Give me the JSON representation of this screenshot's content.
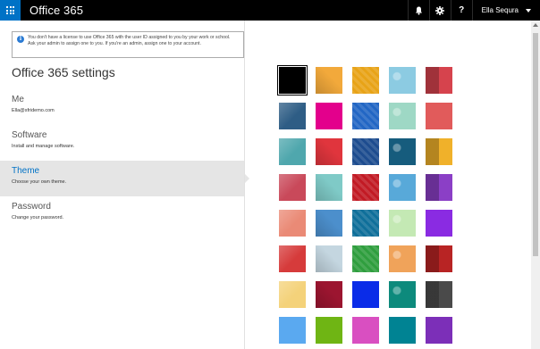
{
  "app": {
    "brand": "Office 365"
  },
  "topbar": {
    "user_name": "Ella Sequra",
    "icons": [
      "bell-icon",
      "gear-icon",
      "help-icon"
    ],
    "help_glyph": "?"
  },
  "notice": {
    "text": "You don't have a license to use Office 365 with the user ID assigned to you by your work or school. Ask your admin to assign one to you. If you're an admin, assign one to your account."
  },
  "settings": {
    "title": "Office 365 settings",
    "items": [
      {
        "label": "Me",
        "sub": "Ella@sfridemo.com"
      },
      {
        "label": "Software",
        "sub": "Install and manage software."
      },
      {
        "label": "Theme",
        "sub": "Choose your own theme.",
        "active": true
      },
      {
        "label": "Password",
        "sub": "Change your password."
      }
    ]
  },
  "themes": [
    {
      "name": "black",
      "color": "#000000",
      "selected": true
    },
    {
      "name": "stars",
      "color": "#f2a93b"
    },
    {
      "name": "blocks",
      "color": "#e8a317"
    },
    {
      "name": "sea",
      "color": "#8ccbe2"
    },
    {
      "name": "palms",
      "color": "#d6434d"
    },
    {
      "name": "landscape",
      "color": "#2e5d85"
    },
    {
      "name": "magenta",
      "color": "#e3008c"
    },
    {
      "name": "blue-waves",
      "color": "#2266c4"
    },
    {
      "name": "mint-pattern",
      "color": "#9ed8c5"
    },
    {
      "name": "red",
      "color": "#e15b5b"
    },
    {
      "name": "robot",
      "color": "#4fa7ad"
    },
    {
      "name": "red-geometric",
      "color": "#e0353d"
    },
    {
      "name": "blue-lines",
      "color": "#1d4c8f"
    },
    {
      "name": "circuit",
      "color": "#165c7d"
    },
    {
      "name": "yellow-zigzag",
      "color": "#f0b12a"
    },
    {
      "name": "pink-bokeh",
      "color": "#c9495a"
    },
    {
      "name": "teal-origami",
      "color": "#7fcac7"
    },
    {
      "name": "checker-red",
      "color": "#c21a24"
    },
    {
      "name": "rainbow",
      "color": "#58a9d9"
    },
    {
      "name": "purple-green",
      "color": "#8b3fc6"
    },
    {
      "name": "salmon",
      "color": "#ea8a76"
    },
    {
      "name": "blue-triangles",
      "color": "#4c8fcc"
    },
    {
      "name": "teal",
      "color": "#0f6f9a"
    },
    {
      "name": "light-green",
      "color": "#c4e9b4"
    },
    {
      "name": "purple",
      "color": "#8a2be2"
    },
    {
      "name": "red-texture",
      "color": "#d63b3b"
    },
    {
      "name": "ice",
      "color": "#c4d6e0"
    },
    {
      "name": "green-lines",
      "color": "#2f9e3e"
    },
    {
      "name": "stripes",
      "color": "#f0a35a"
    },
    {
      "name": "red-green",
      "color": "#b82424"
    },
    {
      "name": "cat",
      "color": "#f4d27a"
    },
    {
      "name": "crimson",
      "color": "#9c1530"
    },
    {
      "name": "royal-blue",
      "color": "#0a2ce8"
    },
    {
      "name": "teal-black",
      "color": "#0d8a7c"
    },
    {
      "name": "gray-black",
      "color": "#4a4a4a"
    },
    {
      "name": "sky-blue",
      "color": "#5aa9f0"
    },
    {
      "name": "lime",
      "color": "#6fb514"
    },
    {
      "name": "pink",
      "color": "#d94fc1"
    },
    {
      "name": "dark-teal",
      "color": "#008393"
    },
    {
      "name": "violet",
      "color": "#7c2fb8"
    }
  ]
}
